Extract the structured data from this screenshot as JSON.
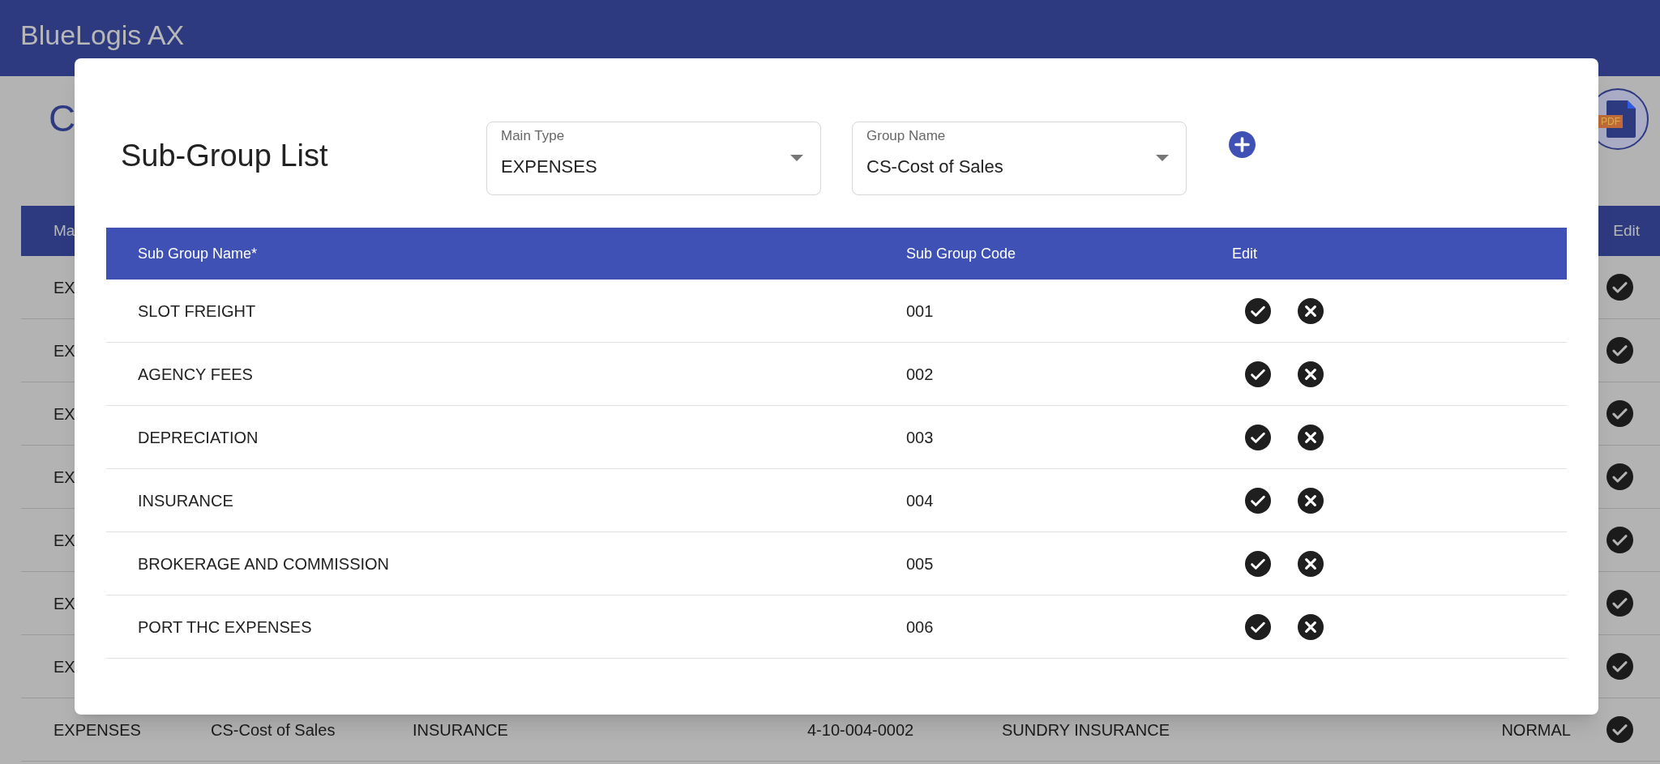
{
  "app_bar": {
    "title": "BlueLogis AX"
  },
  "page": {
    "title": "C",
    "pdf_badge": "PDF"
  },
  "background_table": {
    "columns": [
      "Ma",
      "Edit"
    ],
    "rows": [
      {
        "cells": [
          "EX"
        ]
      },
      {
        "cells": [
          "EX"
        ]
      },
      {
        "cells": [
          "EX"
        ]
      },
      {
        "cells": [
          "EX"
        ]
      },
      {
        "cells": [
          "EX"
        ]
      },
      {
        "cells": [
          "EX"
        ]
      },
      {
        "cells": [
          "EX"
        ]
      },
      {
        "cells": [
          "EXPENSES",
          "CS-Cost of Sales",
          "INSURANCE",
          "4-10-004-0002",
          "SUNDRY INSURANCE",
          "NORMAL"
        ]
      }
    ]
  },
  "dialog": {
    "title": "Sub-Group List",
    "filters": [
      {
        "label": "Main Type",
        "value": "EXPENSES"
      },
      {
        "label": "Group Name",
        "value": "CS-Cost of Sales"
      }
    ],
    "table": {
      "columns": [
        "Sub Group Name*",
        "Sub Group Code",
        "Edit"
      ],
      "rows": [
        {
          "name": "SLOT FREIGHT",
          "code": "001"
        },
        {
          "name": "AGENCY FEES",
          "code": "002"
        },
        {
          "name": "DEPRECIATION",
          "code": "003"
        },
        {
          "name": "INSURANCE",
          "code": "004"
        },
        {
          "name": "BROKERAGE AND COMMISSION",
          "code": "005"
        },
        {
          "name": "PORT THC EXPENSES",
          "code": "006"
        }
      ]
    }
  }
}
